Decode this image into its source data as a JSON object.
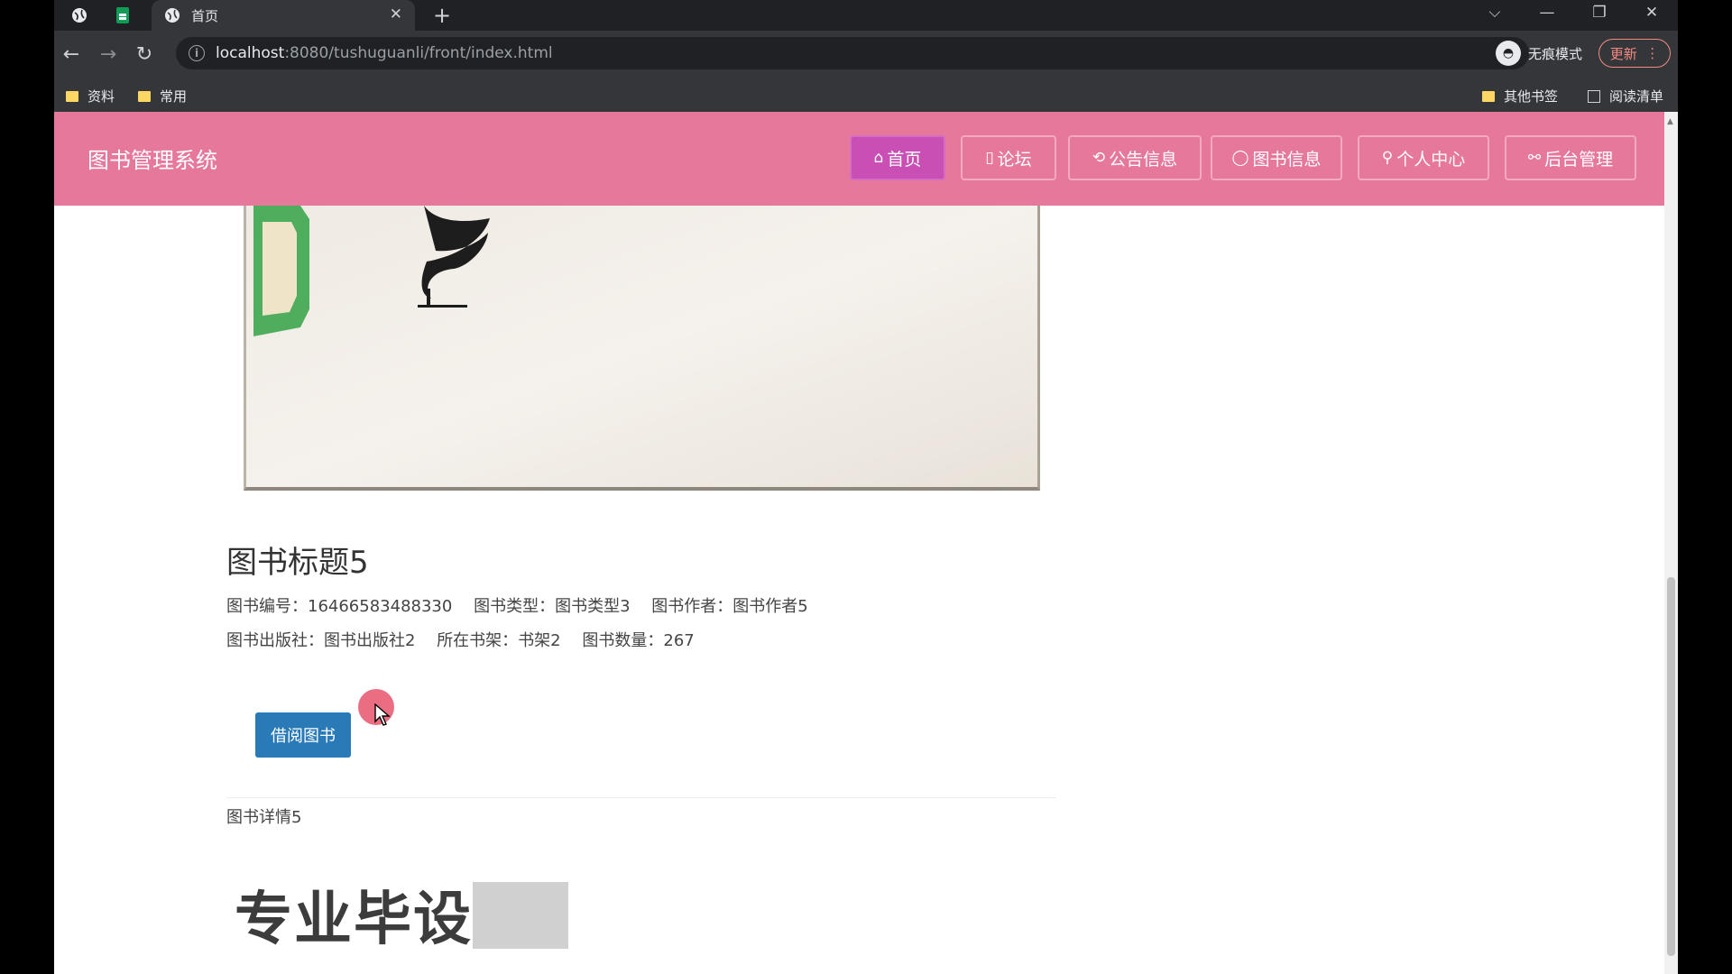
{
  "browser": {
    "tab_title": "首页",
    "url_host": "localhost",
    "url_rest": ":8080/tushuguanli/front/index.html",
    "incognito_label": "无痕模式",
    "update_label": "更新",
    "bookmarks": [
      "资料",
      "常用"
    ],
    "bookmarks_right": [
      "其他书签",
      "阅读清单"
    ]
  },
  "site": {
    "logo": "图书管理系统",
    "nav": [
      {
        "icon": "home-icon",
        "glyph": "⌂",
        "label": "首页"
      },
      {
        "icon": "forum-icon",
        "glyph": "▯",
        "label": "论坛"
      },
      {
        "icon": "notice-icon",
        "glyph": "⟲",
        "label": "公告信息"
      },
      {
        "icon": "book-icon",
        "glyph": "◯",
        "label": "图书信息"
      },
      {
        "icon": "user-icon",
        "glyph": "⚲",
        "label": "个人中心"
      },
      {
        "icon": "link-icon",
        "glyph": "⚯",
        "label": "后台管理"
      }
    ],
    "accent_color": "#e6789c"
  },
  "book": {
    "title": "图书标题5",
    "fields_row1": [
      {
        "label": "图书编号：",
        "value": "16466583488330"
      },
      {
        "label": "图书类型：",
        "value": "图书类型3"
      },
      {
        "label": "图书作者：",
        "value": "图书作者5"
      }
    ],
    "fields_row2": [
      {
        "label": "图书出版社：",
        "value": "图书出版社2"
      },
      {
        "label": "所在书架：",
        "value": "书架2"
      },
      {
        "label": "图书数量：",
        "value": "267"
      }
    ],
    "borrow_label": "借阅图书",
    "detail": "图书详情5"
  },
  "watermark": "专业毕设"
}
